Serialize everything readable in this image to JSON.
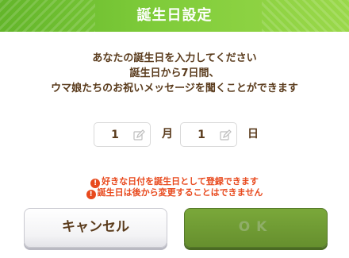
{
  "dialog": {
    "title": "誕生日設定",
    "desc_line1": "あなたの誕生日を入力してください",
    "desc_line2": "誕生日から7日間、",
    "desc_line3": "ウマ娘たちのお祝いメッセージを聞くことができます",
    "month_value": "1",
    "month_unit": "月",
    "day_value": "1",
    "day_unit": "日",
    "warn1": "好きな日付を誕生日として登録できます",
    "warn2": "誕生日は後から変更することはできません",
    "cancel_label": "キャンセル",
    "ok_label": "OK"
  },
  "colors": {
    "header_green": "#7fcc3a",
    "text_brown": "#5a3b1c",
    "warning_red": "#e8491d",
    "ok_disabled_green": "#668f2e"
  },
  "icons": [
    "pencil-icon",
    "exclamation-icon"
  ]
}
